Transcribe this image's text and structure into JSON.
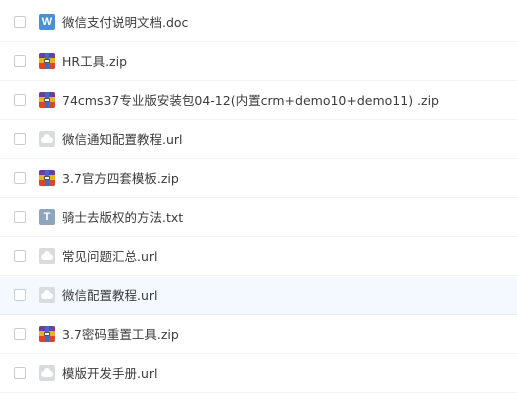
{
  "file_list": {
    "items": [
      {
        "name": "微信支付说明文档.doc",
        "icon": "word-doc-icon",
        "selected": false
      },
      {
        "name": "HR工具.zip",
        "icon": "zip-archive-icon",
        "selected": false
      },
      {
        "name": "74cms37专业版安装包04-12(内置crm+demo10+demo11) .zip",
        "icon": "zip-archive-icon",
        "selected": false
      },
      {
        "name": "微信通知配置教程.url",
        "icon": "url-link-icon",
        "selected": false
      },
      {
        "name": "3.7官方四套模板.zip",
        "icon": "zip-archive-icon",
        "selected": false
      },
      {
        "name": "骑士去版权的方法.txt",
        "icon": "text-file-icon",
        "selected": false
      },
      {
        "name": "常见问题汇总.url",
        "icon": "url-link-icon",
        "selected": false
      },
      {
        "name": "微信配置教程.url",
        "icon": "url-link-icon",
        "selected": false
      },
      {
        "name": "3.7密码重置工具.zip",
        "icon": "zip-archive-icon",
        "selected": false
      },
      {
        "name": "模版开发手册.url",
        "icon": "url-link-icon",
        "selected": false
      }
    ]
  },
  "icons": {
    "word_letter": "W",
    "text_letter": "T"
  },
  "colors": {
    "row_hover_background": "#f4f9ff",
    "file_name_text": "#3b3b3b",
    "word_icon": "#4a8fd8",
    "text_icon": "#8ea6bd",
    "url_icon": "#d8dcdf"
  }
}
